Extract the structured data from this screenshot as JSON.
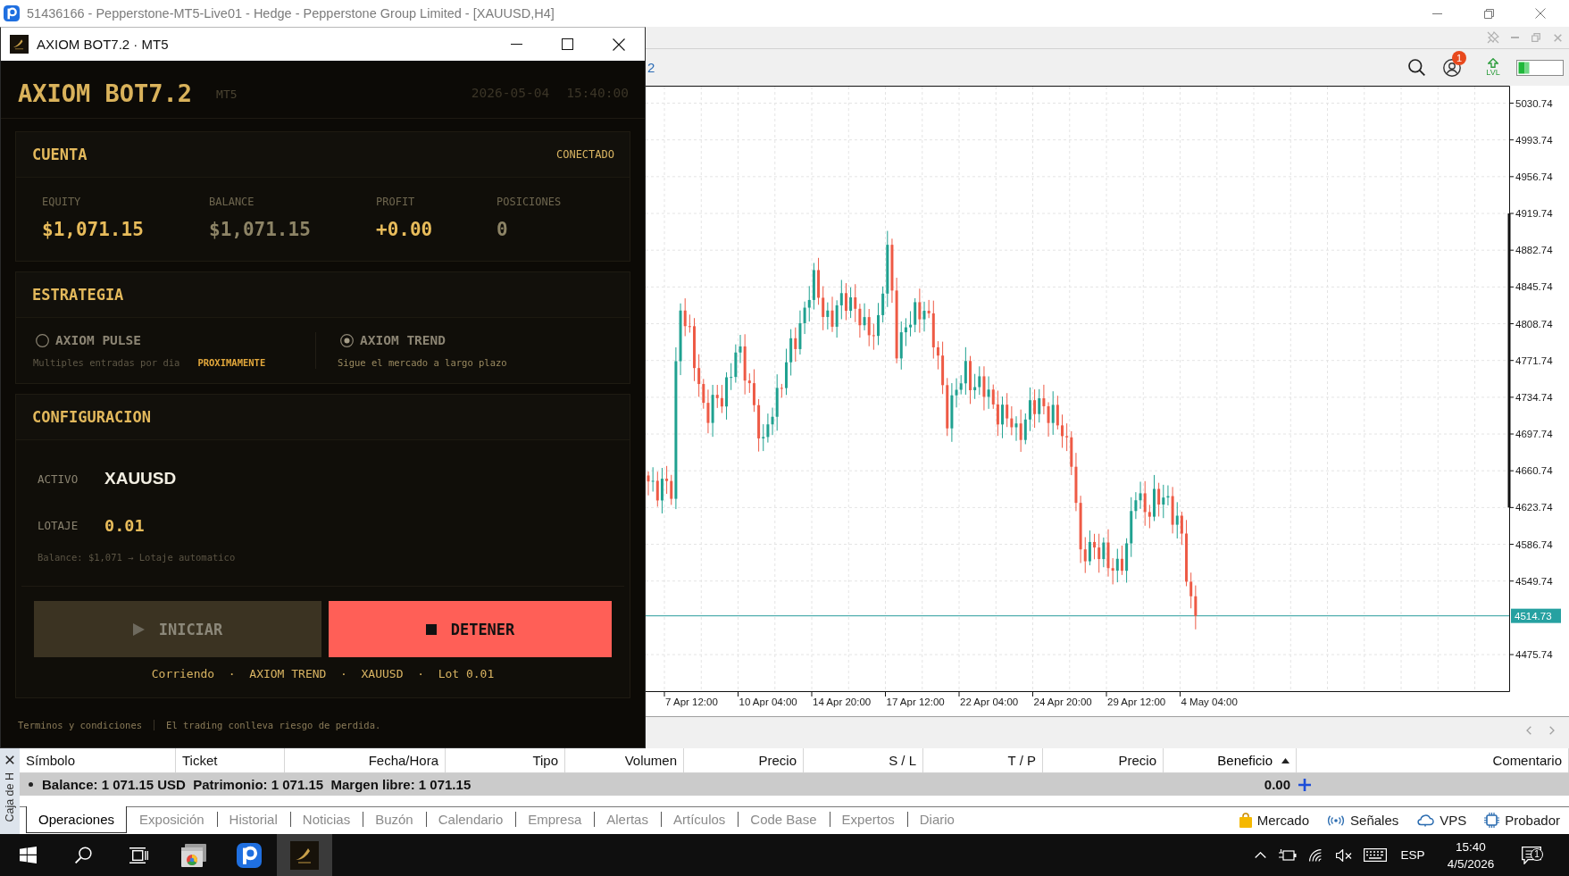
{
  "platform": {
    "title": "51436166 - Pepperstone-MT5-Live01 - Hedge - Pepperstone Group Limited - [XAUUSD,H4]",
    "toolbar": {
      "chart_tab_fragment": "2",
      "notification_badge": "1",
      "level_label": "LVL"
    },
    "chart": {
      "price_labels": [
        "5030.74",
        "4993.74",
        "4956.74",
        "4919.74",
        "4882.74",
        "4845.74",
        "4808.74",
        "4771.74",
        "4734.74",
        "4697.74",
        "4660.74",
        "4623.74",
        "4586.74",
        "4549.74",
        "4475.74"
      ],
      "current_price": "4514.73",
      "time_labels": [
        "7 Apr 12:00",
        "10 Apr 04:00",
        "14 Apr 20:00",
        "17 Apr 12:00",
        "22 Apr 04:00",
        "24 Apr 20:00",
        "29 Apr 12:00",
        "4 May 04:00"
      ]
    },
    "toolbox": {
      "side_label": "Caja de H",
      "columns": [
        {
          "label": "Símbolo",
          "sorted": false
        },
        {
          "label": "Ticket",
          "sorted": false
        },
        {
          "label": "Fecha/Hora",
          "sorted": false
        },
        {
          "label": "Tipo",
          "sorted": false
        },
        {
          "label": "Volumen",
          "sorted": false
        },
        {
          "label": "Precio",
          "sorted": false
        },
        {
          "label": "S / L",
          "sorted": false
        },
        {
          "label": "T / P",
          "sorted": false
        },
        {
          "label": "Precio",
          "sorted": false
        },
        {
          "label": "Beneficio",
          "sorted": true
        },
        {
          "label": "Comentario",
          "sorted": false
        }
      ],
      "summary": "Balance: 1 071.15 USD  Patrimonio: 1 071.15  Margen libre: 1 071.15",
      "profit_total": "0.00",
      "tabs": [
        {
          "label": "Operaciones",
          "selected": true
        },
        {
          "label": "Exposición",
          "selected": false
        },
        {
          "label": "Historial",
          "selected": false
        },
        {
          "label": "Noticias",
          "selected": false
        },
        {
          "label": "Buzón",
          "selected": false
        },
        {
          "label": "Calendario",
          "selected": false
        },
        {
          "label": "Empresa",
          "selected": false
        },
        {
          "label": "Alertas",
          "selected": false
        },
        {
          "label": "Artículos",
          "selected": false
        },
        {
          "label": "Code Base",
          "selected": false
        },
        {
          "label": "Expertos",
          "selected": false
        },
        {
          "label": "Diario",
          "selected": false
        }
      ],
      "services": [
        {
          "kind": "market",
          "label": "Mercado"
        },
        {
          "kind": "signals",
          "label": "Señales"
        },
        {
          "kind": "vps",
          "label": "VPS"
        },
        {
          "kind": "tester",
          "label": "Probador"
        }
      ]
    }
  },
  "bot": {
    "title": "AXIOM BOT7.2 · MT5",
    "name": "AXIOM BOT7.2",
    "platform_label": "MT5",
    "date": "2026-05-04",
    "time": "15:40:00",
    "account": {
      "title": "CUENTA",
      "status": "CONECTADO",
      "stats": [
        {
          "label": "EQUITY",
          "value": "$1,071.15",
          "kind": "primary"
        },
        {
          "label": "BALANCE",
          "value": "$1,071.15",
          "kind": "secondary"
        },
        {
          "label": "PROFIT",
          "value": "+0.00",
          "kind": "primary"
        },
        {
          "label": "POSICIONES",
          "value": "0",
          "kind": "secondary"
        }
      ]
    },
    "strategy": {
      "title": "ESTRATEGIA",
      "options": [
        {
          "name": "AXIOM PULSE",
          "description": "Multiples entradas por dia",
          "badge": "PROXIMAMENTE",
          "selected": false,
          "disabled": true
        },
        {
          "name": "AXIOM TREND",
          "description": "Sigue el mercado a largo plazo",
          "selected": true,
          "disabled": false
        }
      ]
    },
    "config": {
      "title": "CONFIGURACION",
      "fields": [
        {
          "label": "ACTIVO",
          "value": "XAUUSD",
          "kind": "symbol"
        },
        {
          "label": "LOTAJE",
          "value": "0.01",
          "kind": "amount"
        }
      ],
      "hint": "Balance: $1,071 → Lotaje automatico",
      "buttons": [
        {
          "label": "INICIAR",
          "kind": "start",
          "disabled": true
        },
        {
          "label": "DETENER",
          "kind": "stop",
          "disabled": false
        }
      ],
      "status": "Corriendo  ·  AXIOM TREND  ·  XAUUSD  ·  Lot 0.01"
    },
    "footer": {
      "link": "Terminos y condiciones",
      "disclaimer": "El trading conlleva riesgo de perdida."
    }
  },
  "taskbar": {
    "items": [
      {
        "kind": "start",
        "selected": false
      },
      {
        "kind": "search",
        "selected": false
      },
      {
        "kind": "task_view",
        "selected": false
      },
      {
        "kind": "browser",
        "selected": false
      },
      {
        "kind": "logo",
        "selected": false
      },
      {
        "kind": "bot",
        "selected": true
      }
    ],
    "language": "ESP",
    "time": "15:40",
    "date": "4/5/2026",
    "notification_badge": "1"
  }
}
